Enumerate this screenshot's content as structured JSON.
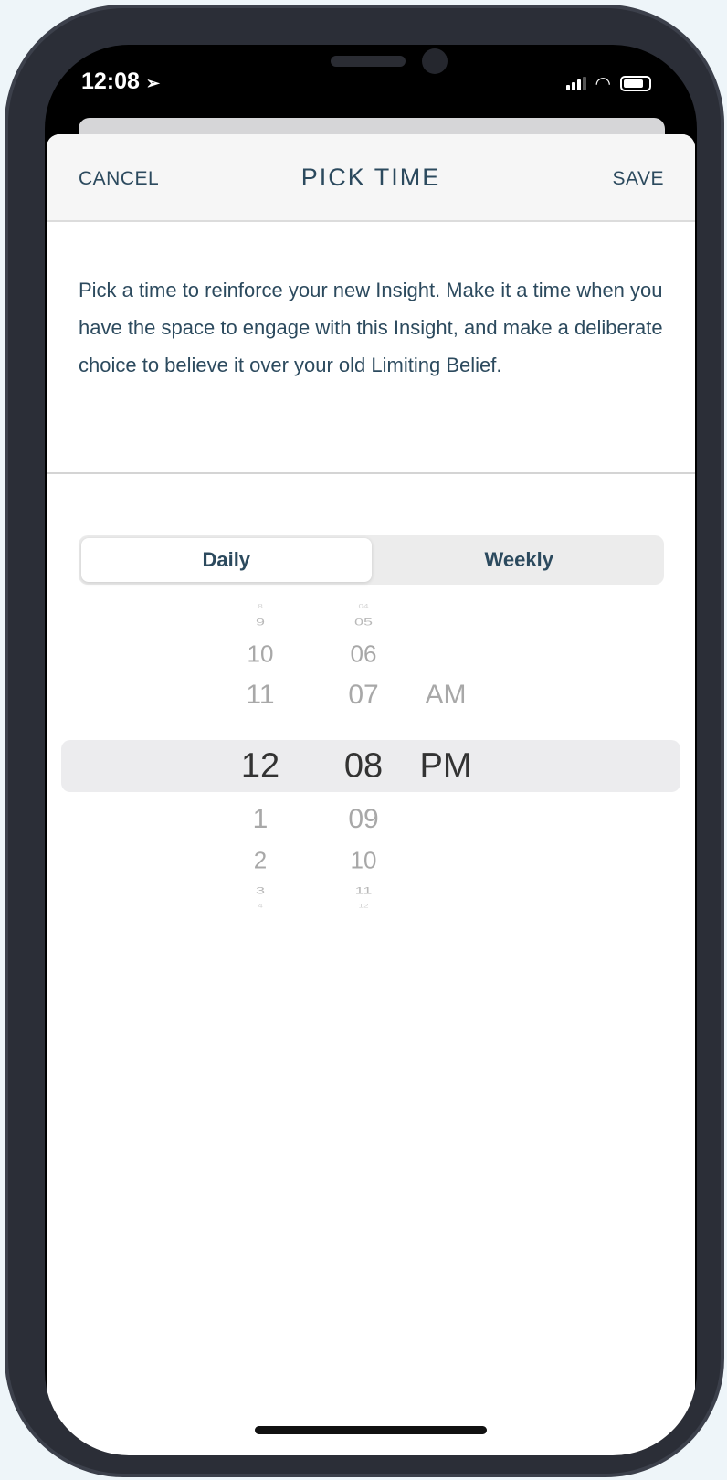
{
  "status": {
    "time": "12:08"
  },
  "header": {
    "cancel": "CANCEL",
    "title": "PICK TIME",
    "save": "SAVE"
  },
  "description": "Pick a time to reinforce your new Insight. Make it a time when you have the space to engage with this Insight, and make a deliberate choice to believe it over your old Limiting Belief.",
  "segment": {
    "options": [
      "Daily",
      "Weekly"
    ],
    "selected": "Daily"
  },
  "picker": {
    "hours": [
      "8",
      "9",
      "10",
      "11",
      "12",
      "1",
      "2",
      "3",
      "4"
    ],
    "minutes": [
      "04",
      "05",
      "06",
      "07",
      "08",
      "09",
      "10",
      "11",
      "12"
    ],
    "period": [
      "AM",
      "PM"
    ],
    "selected": {
      "hour": "12",
      "minute": "08",
      "period": "PM"
    }
  },
  "colors": {
    "text": "#2c4a5e",
    "phone": "#2b2e37"
  }
}
